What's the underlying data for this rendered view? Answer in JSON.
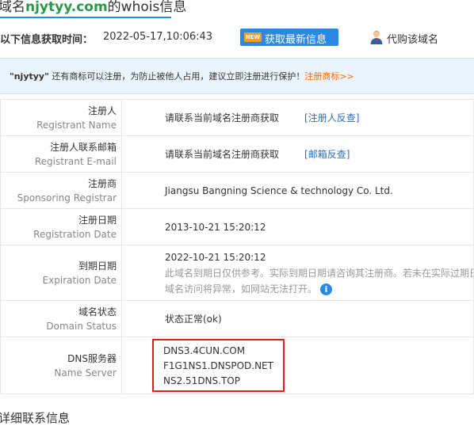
{
  "title": {
    "prefix": "域名",
    "domain": "njytyy.com",
    "suffix": "的whois信息"
  },
  "fetch": {
    "label": "以下信息获取时间：",
    "time": "2022-05-17,10:06:43",
    "badge": "NEW",
    "button": "获取最新信息"
  },
  "agent": {
    "label": "代购该域名",
    "icon": "person-icon"
  },
  "notice": {
    "domain": "\"njytyy\"",
    "text": " 还有商标可以注册，为防止被他人占用，建议立即注册进行保护！",
    "link": "注册商标>>"
  },
  "rows": {
    "registrant": {
      "cn": "注册人",
      "en": "Registrant Name",
      "value": "请联系当前域名注册商获取",
      "link": "[注册人反查]"
    },
    "email": {
      "cn": "注册人联系邮箱",
      "en": "Registrant E-mail",
      "value": "请联系当前域名注册商获取",
      "link": "[邮箱反查]"
    },
    "registrar": {
      "cn": "注册商",
      "en": "Sponsoring Registrar",
      "value": "Jiangsu Bangning Science & technology Co. Ltd."
    },
    "created": {
      "cn": "注册日期",
      "en": "Registration Date",
      "value": "2013-10-21 15:20:12"
    },
    "expires": {
      "cn": "到期日期",
      "en": "Expiration Date",
      "value": "2022-10-21 15:20:12",
      "note1": "此域名到期日仅供参考。实际到期日期请咨询其注册商。若未在实际过期日",
      "note2": "域名访问将异常，如网站无法打开。",
      "icon": "i"
    },
    "status": {
      "cn": "域名状态",
      "en": "Domain Status",
      "value": "状态正常(ok)"
    },
    "dns": {
      "cn": "DNS服务器",
      "en": "Name Server",
      "values": [
        "DNS3.4CUN.COM",
        "F1G1NS1.DNSPOD.NET",
        "NS2.51DNS.TOP"
      ]
    }
  },
  "footer_partial": "详细联系信息",
  "colors": {
    "accent": "#2b88e5",
    "domain_green": "#2a9a47",
    "notice_orange": "#ff6a00",
    "highlight_red": "#e02020",
    "badge_orange": "#ff9b1a"
  }
}
